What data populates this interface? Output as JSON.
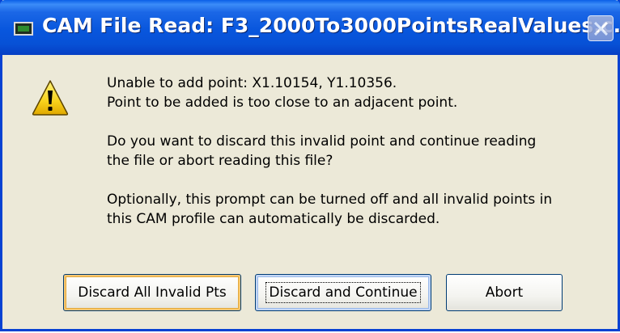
{
  "window": {
    "title": "CAM File Read: F3_2000To3000PointsRealValues.c...",
    "icon": "cam-app-icon",
    "close_icon": "close-icon"
  },
  "dialog": {
    "icon": "warning-icon",
    "message_lines": [
      [
        "Unable to add point:  X1.10154, Y1.10356.",
        "Point to be added is too close to an adjacent point."
      ],
      [
        "Do you want to discard this invalid point and continue reading",
        "the file or abort reading this file?"
      ],
      [
        "Optionally, this prompt can be turned off and all invalid points in",
        "this CAM profile can automatically be discarded."
      ]
    ]
  },
  "buttons": {
    "discard_all": "Discard All Invalid Pts",
    "discard_continue": "Discard and Continue",
    "abort": "Abort"
  },
  "colors": {
    "titlebar": "#0853dc",
    "dialog_bg": "#ece9d8",
    "warning_yellow": "#f8d21c"
  }
}
